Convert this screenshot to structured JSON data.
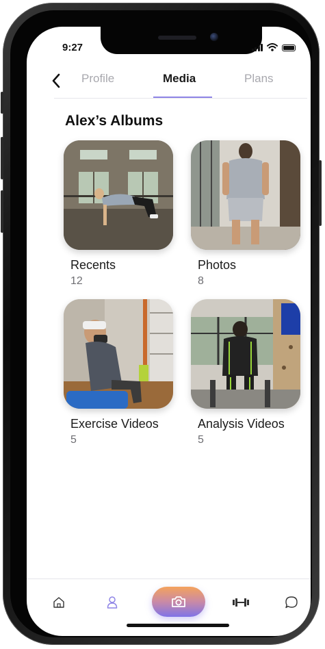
{
  "status": {
    "time": "9:27"
  },
  "header": {
    "tabs": [
      {
        "label": "Profile",
        "active": false
      },
      {
        "label": "Media",
        "active": true
      },
      {
        "label": "Plans",
        "active": false
      }
    ]
  },
  "albums_title": "Alex’s Albums",
  "albums": [
    {
      "name": "Recents",
      "count": "12"
    },
    {
      "name": "Photos",
      "count": "8"
    },
    {
      "name": "Exercise Videos",
      "count": "5"
    },
    {
      "name": "Analysis Videos",
      "count": "5"
    }
  ],
  "nav": {
    "items": [
      "home-icon",
      "profile-icon",
      "camera-icon",
      "dumbbell-icon",
      "chat-icon"
    ],
    "active": "profile-icon"
  },
  "colors": {
    "accent": "#8e84e6",
    "camera_gradient_top": "#f4a35c",
    "camera_gradient_bottom": "#7f73e8"
  }
}
